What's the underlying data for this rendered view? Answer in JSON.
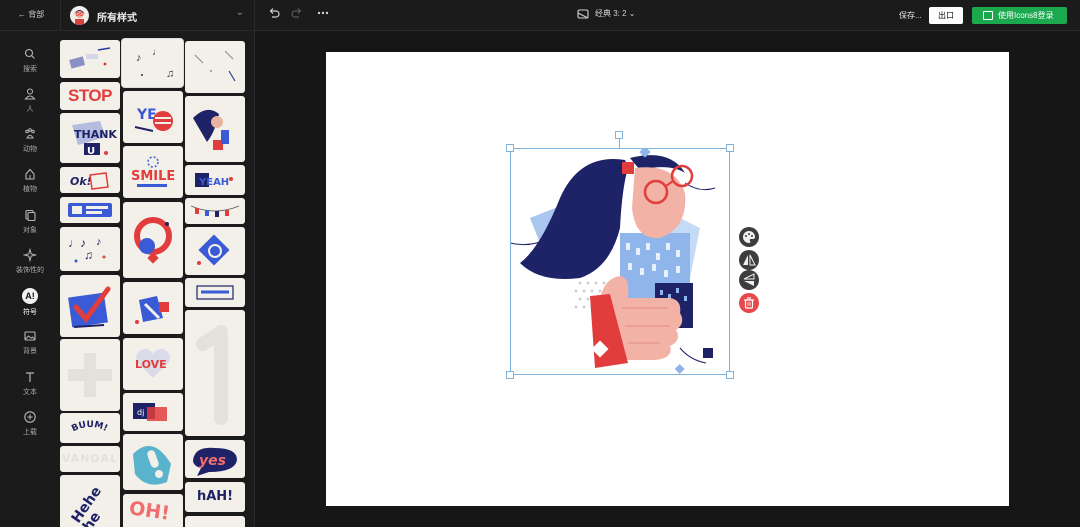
{
  "header": {
    "back_label": "← 背部",
    "set_title": "所有样式",
    "chevron": "⌄",
    "undo_icon": "undo-icon",
    "redo_icon": "redo-icon",
    "more_icon": "more-icon",
    "ratio_label": "经典 3: 2 ⌄",
    "saving": "保存...",
    "export_label": "出口",
    "login_label": "使用Icons8登录"
  },
  "nav": [
    {
      "label": "搜索",
      "icon": "search-icon"
    },
    {
      "label": "人",
      "icon": "person-icon"
    },
    {
      "label": "动物",
      "icon": "paw-icon"
    },
    {
      "label": "植物",
      "icon": "plant-icon"
    },
    {
      "label": "对象",
      "icon": "object-icon"
    },
    {
      "label": "装饰性的",
      "icon": "sparkle-icon"
    },
    {
      "label": "符号",
      "icon": "symbol-icon",
      "badge": "A!",
      "active": true
    },
    {
      "label": "背景",
      "icon": "image-icon"
    },
    {
      "label": "文本",
      "icon": "text-icon"
    },
    {
      "label": "上载",
      "icon": "upload-icon"
    }
  ],
  "stickers": {
    "stop": "STOP",
    "thank_you": "THANK YOU",
    "smile": "SMILE",
    "buum": "BUUM!",
    "yes": "yes",
    "hah": "hAH!",
    "oh": "OH!",
    "vandal": "VANDAL",
    "hehe": "Hehe he",
    "love": "LOVE",
    "yeah": "YEAH"
  },
  "colors": {
    "accent_green": "#1ca84d",
    "delete_red": "#e6484c",
    "navy": "#1e2266",
    "red": "#e23d3d"
  }
}
